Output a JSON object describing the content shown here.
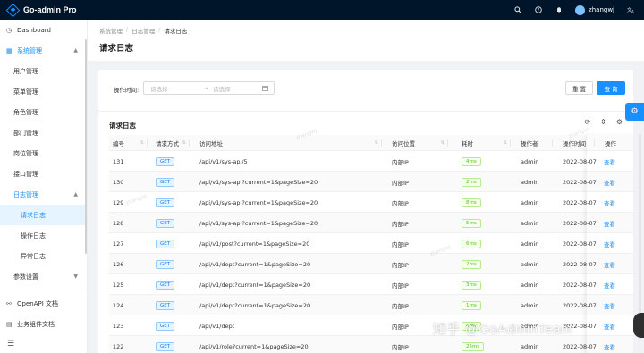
{
  "app": {
    "title": "Go-admin Pro"
  },
  "header": {
    "username": "zhangwj"
  },
  "sidebar": {
    "items": [
      {
        "label": "Dashboard",
        "icon": "dashboard-icon"
      },
      {
        "label": "系统管理",
        "icon": "grid-icon"
      },
      {
        "label": "用户管理"
      },
      {
        "label": "菜单管理"
      },
      {
        "label": "角色管理"
      },
      {
        "label": "部门管理"
      },
      {
        "label": "岗位管理"
      },
      {
        "label": "接口管理"
      },
      {
        "label": "日志管理"
      },
      {
        "label": "请求日志"
      },
      {
        "label": "操作日志"
      },
      {
        "label": "异常日志"
      },
      {
        "label": "参数设置"
      },
      {
        "label": "OpenAPI 文档",
        "icon": "link-icon"
      },
      {
        "label": "业务组件文档",
        "icon": "doc-icon"
      }
    ]
  },
  "breadcrumb": [
    "系统管理",
    "日志管理",
    "请求日志"
  ],
  "page": {
    "title": "请求日志"
  },
  "search": {
    "label": "操作时间:",
    "start_placeholder": "请选择",
    "end_placeholder": "请选择",
    "arrow": "→",
    "reset_label": "重 置",
    "query_label": "查 询"
  },
  "table": {
    "title": "请求日志",
    "columns": [
      "编号",
      "请求方式",
      "访问地址",
      "访问位置",
      "耗时",
      "操作者",
      "操作时间",
      "操作"
    ],
    "rows": [
      {
        "id": "131",
        "method": "GET",
        "url": "/api/v1/sys-api/5",
        "location": "内部IP",
        "cost": "4ms",
        "operator": "admin",
        "time": "2022-08-07",
        "action": "查看"
      },
      {
        "id": "130",
        "method": "GET",
        "url": "/api/v1/sys-api?current=1&pageSize=20",
        "location": "内部IP",
        "cost": "2ms",
        "operator": "admin",
        "time": "2022-08-07",
        "action": "查看"
      },
      {
        "id": "129",
        "method": "GET",
        "url": "/api/v1/sys-api?current=1&pageSize=20",
        "location": "内部IP",
        "cost": "8ms",
        "operator": "admin",
        "time": "2022-08-07",
        "action": "查看"
      },
      {
        "id": "128",
        "method": "GET",
        "url": "/api/v1/sys-api?current=1&pageSize=20",
        "location": "内部IP",
        "cost": "5ms",
        "operator": "admin",
        "time": "2022-08-07",
        "action": "查看"
      },
      {
        "id": "127",
        "method": "GET",
        "url": "/api/v1/post?current=1&pageSize=20",
        "location": "内部IP",
        "cost": "6ms",
        "operator": "admin",
        "time": "2022-08-07",
        "action": "查看"
      },
      {
        "id": "126",
        "method": "GET",
        "url": "/api/v1/dept?current=1&pageSize=20",
        "location": "内部IP",
        "cost": "2ms",
        "operator": "admin",
        "time": "2022-08-07",
        "action": "查看"
      },
      {
        "id": "125",
        "method": "GET",
        "url": "/api/v1/dept?current=1&pageSize=20",
        "location": "内部IP",
        "cost": "3ms",
        "operator": "admin",
        "time": "2022-08-07",
        "action": "查看"
      },
      {
        "id": "124",
        "method": "GET",
        "url": "/api/v1/dept?current=1&pageSize=20",
        "location": "内部IP",
        "cost": "1ms",
        "operator": "admin",
        "time": "2022-08-07",
        "action": "查看"
      },
      {
        "id": "123",
        "method": "GET",
        "url": "/api/v1/dept",
        "location": "内部IP",
        "cost": "4ms",
        "operator": "admin",
        "time": "2022-08-07",
        "action": "查看"
      },
      {
        "id": "122",
        "method": "GET",
        "url": "/api/v1/role?current=1&pageSize=20",
        "location": "内部IP",
        "cost": "25ms",
        "operator": "admin",
        "time": "2022-08-07",
        "action": "查看"
      }
    ]
  },
  "watermarks": [
    "zhangwj"
  ],
  "overlay_watermark": "知乎 @GoAdminTeam"
}
